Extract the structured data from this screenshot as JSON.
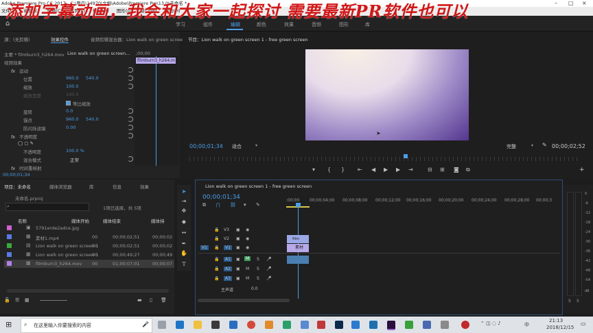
{
  "window": {
    "title": "Adobe Premiere Pro CC 2017 - C:\\用户\\24970\\文档\\Adobe\\Premiere Pro\\13.0\\未命名 *"
  },
  "overlay": {
    "text": "添加字幕动画，我会和大家一起探讨 需要最新PR软件也可以"
  },
  "menu": [
    "文件(F)",
    "编辑(E)",
    "剪辑(C)",
    "序列(S)",
    "标记(M)",
    "图形(G)",
    "窗口(W)",
    "帮助(H)"
  ],
  "workspaces": {
    "items": [
      "学习",
      "组件",
      "编辑",
      "颜色",
      "效果",
      "音频",
      "图形",
      "库"
    ],
    "active": "编辑"
  },
  "effect_controls": {
    "tabs": [
      "源：(无剪辑)",
      "效果控件",
      "音频剪辑混合器：Lion walk on green screen 1"
    ],
    "master_clip": "主要 * filmburn3_h264.mov",
    "sequence_clip": "Lion walk on green screen...",
    "timecode_start": ";00;00",
    "clip_chip": "filmburn3_h264.m",
    "section_video": "视频效果",
    "motion": "运动",
    "position": {
      "label": "位置",
      "x": "960.0",
      "y": "540.0"
    },
    "scale": {
      "label": "缩放",
      "value": "100.0"
    },
    "scale_width": {
      "label": "缩放宽度",
      "value": "100.0"
    },
    "uniform": "等比缩放",
    "rotation": {
      "label": "旋转",
      "value": "0.0"
    },
    "anchor": {
      "label": "锚点",
      "x": "960.0",
      "y": "540.0"
    },
    "antiflicker": {
      "label": "防闪烁滤镜",
      "value": "0.00"
    },
    "opacity_section": "不透明度",
    "opacity": {
      "label": "不透明度",
      "value": "100.0 %"
    },
    "blend": {
      "label": "混合模式",
      "value": "正常"
    },
    "time_remap": "时间重映射",
    "footer_timecode": "00;00;01;34"
  },
  "program": {
    "title": "节目：Lion walk on green screen 1 - free green screen",
    "timecode": "00;00;01;34",
    "fit": "适合",
    "quality": "完整",
    "duration": "00;00;02;52"
  },
  "project": {
    "tabs": [
      "项目：未命名",
      "媒体浏览器",
      "库",
      "信息",
      "效果"
    ],
    "file": "未命名.prproj",
    "selection": "1项已选择，共 5项",
    "columns": [
      "名称",
      "媒体开始",
      "媒体结束",
      "媒体持"
    ],
    "items": [
      {
        "name": "5791erde2adce.jpg",
        "start": "",
        "end": "",
        "dur": "",
        "color": "#d060d0"
      },
      {
        "name": "素材1.mp4",
        "start": "00",
        "end": "00;00;02;51",
        "dur": "00;00;02",
        "color": "#5a78e6"
      },
      {
        "name": "Lion walk on green screen 1",
        "start": "00",
        "end": "00;00;02;51",
        "dur": "00;00;02",
        "color": "#3aaa3a"
      },
      {
        "name": "Lion walk on green screen 1",
        "start": "00",
        "end": "00;00;49;27",
        "dur": "00;00;49",
        "color": "#5a78e6"
      },
      {
        "name": "filmburn3_h264.mov",
        "start": "00",
        "end": "01;00;07;01",
        "dur": "00;00;07",
        "color": "#b080e6"
      }
    ]
  },
  "timeline": {
    "title": "Lion walk on green screen 1 - free green screen",
    "timecode": "00;00;01;34",
    "ruler": [
      ":00;00",
      "00;00;04;00",
      "00;00;08;00",
      "00;00;12;00",
      "00;00;16;00",
      "00;00;20;00",
      "00;00;24;00",
      "00;00;28;00",
      "00;00;3"
    ],
    "tracks": [
      {
        "name": "V3",
        "kind": "video"
      },
      {
        "name": "V2",
        "kind": "video"
      },
      {
        "name": "V1",
        "kind": "video",
        "src": "V1"
      },
      {
        "name": "A1",
        "kind": "audio",
        "src": "A1"
      },
      {
        "name": "A2",
        "kind": "audio"
      },
      {
        "name": "A3",
        "kind": "audio"
      }
    ],
    "clip_v2": "film",
    "clip_v1": "素材",
    "master": "主声道",
    "master_val": "0.0",
    "mute": "M",
    "solo": "S"
  },
  "meter_labels": [
    "S",
    "S"
  ],
  "meter_scale": [
    "0",
    "-6",
    "-12",
    "-18",
    "-24",
    "-30",
    "-36",
    "-42",
    "-48",
    "-54",
    "dB"
  ],
  "taskbar": {
    "search": "在这里输入你要搜索的内容",
    "time": "21:13",
    "date": "2018/12/15",
    "lang": "中"
  },
  "colors": {
    "accent": "#4a9ee8",
    "v1_clip": "#b8a9ea",
    "v2_clip": "#9aa8e6",
    "overlay": "#d01818"
  }
}
